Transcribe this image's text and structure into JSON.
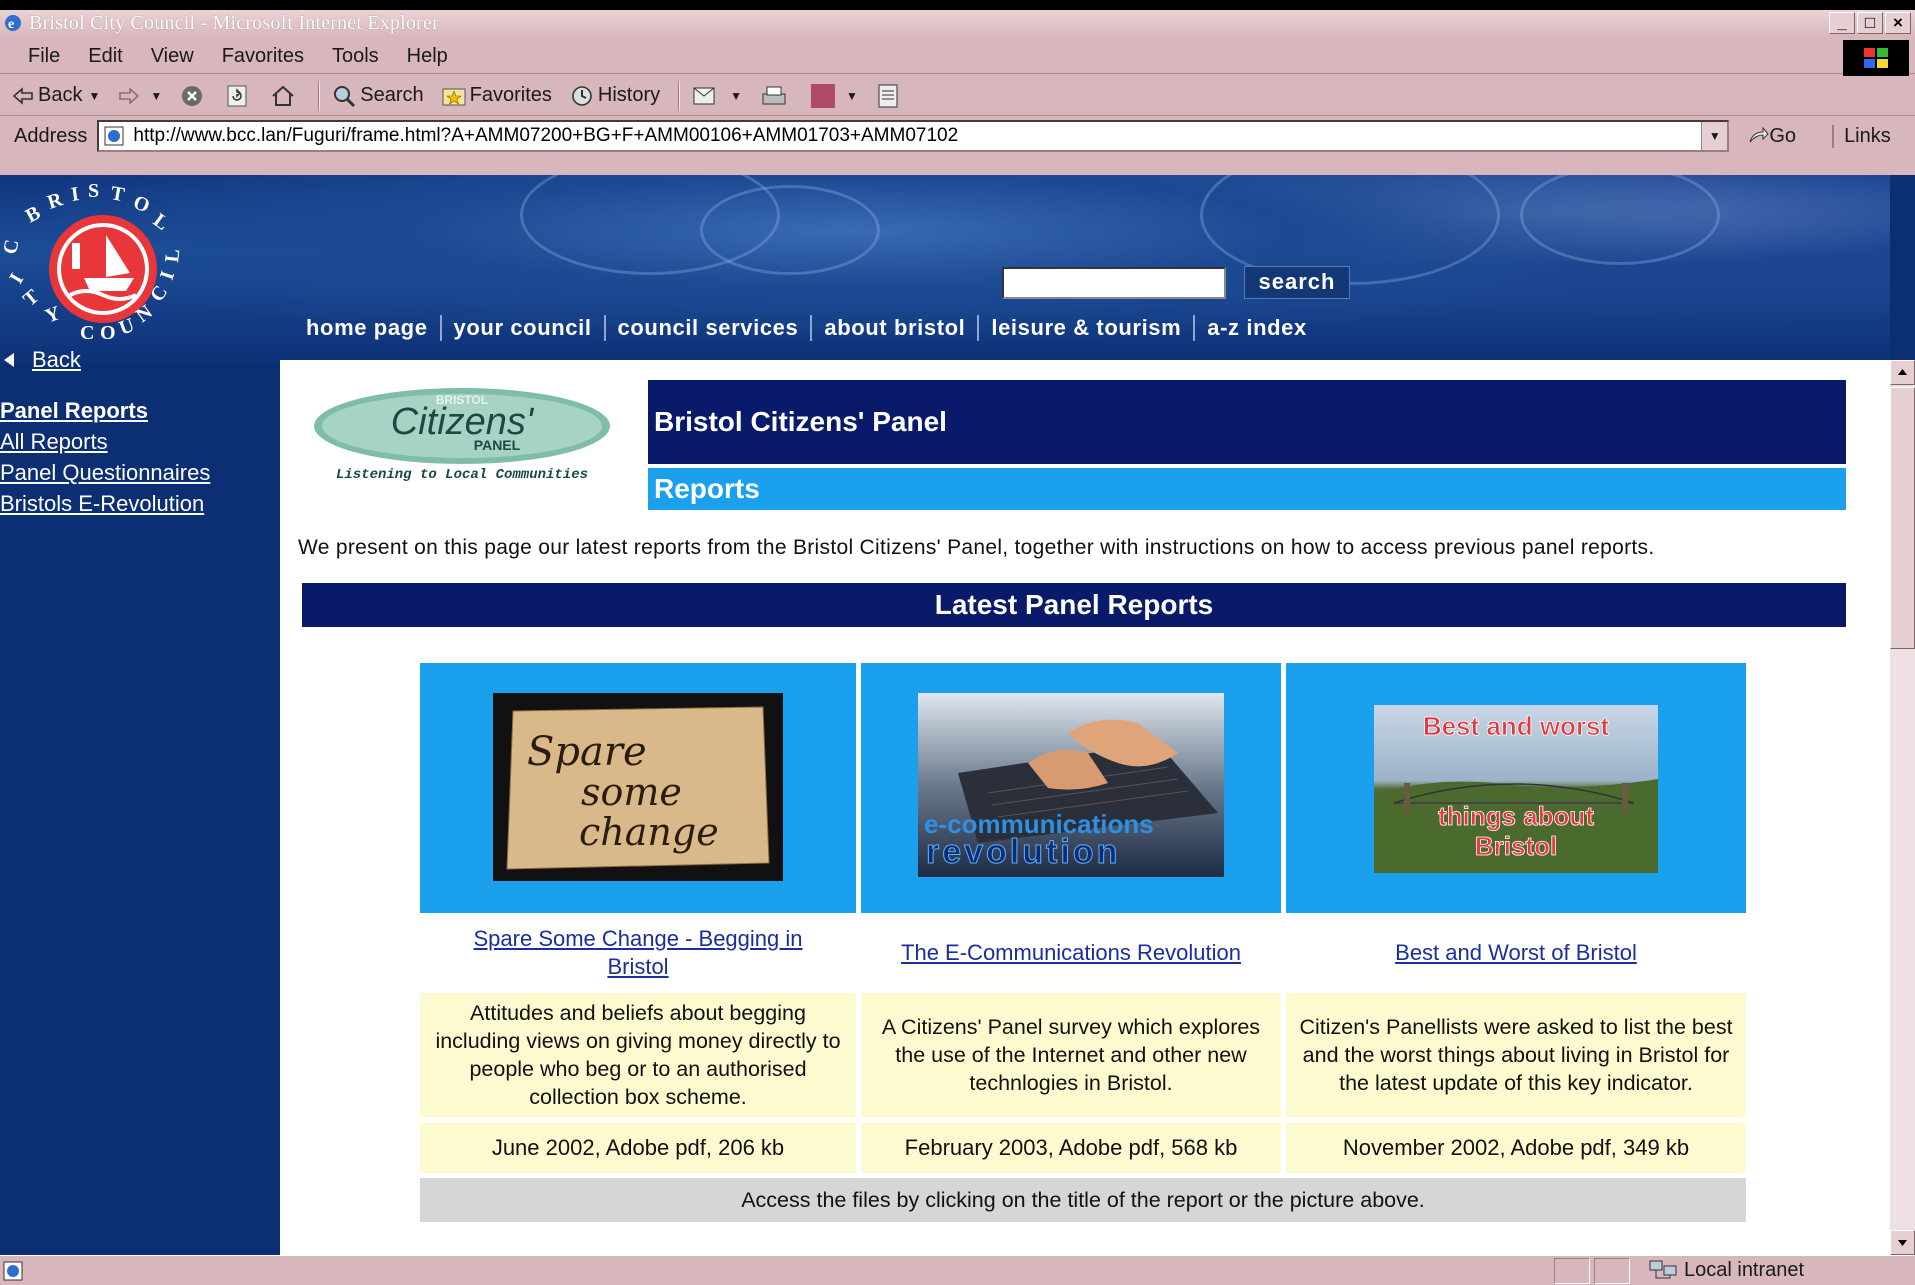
{
  "window": {
    "title": "Bristol City Council - Microsoft Internet Explorer",
    "buttons": {
      "minimize": "_",
      "maximize": "□",
      "close": "×"
    }
  },
  "menubar": [
    "File",
    "Edit",
    "View",
    "Favorites",
    "Tools",
    "Help"
  ],
  "toolbar": {
    "back": "Back",
    "search": "Search",
    "favorites": "Favorites",
    "history": "History"
  },
  "address": {
    "label": "Address",
    "url": "http://www.bcc.lan/Fuguri/frame.html?A+AMM07200+BG+F+AMM00106+AMM01703+AMM07102",
    "go": "Go",
    "links": "Links"
  },
  "site": {
    "logo_text": "BRISTOL CITY COUNCIL",
    "search_button": "search",
    "search_value": "",
    "nav": [
      "home page",
      "your council",
      "council services",
      "about bristol",
      "leisure & tourism",
      "a-z index"
    ]
  },
  "leftnav": {
    "back": "Back",
    "items": [
      "Panel Reports",
      "All Reports",
      "Panel Questionnaires",
      "Bristols E-Revolution"
    ]
  },
  "content": {
    "panel_logo": {
      "top": "BRISTOL",
      "main": "Citizens'",
      "sub": "PANEL",
      "tagline": "Listening to Local Communities"
    },
    "header1": "Bristol Citizens' Panel",
    "header2": "Reports",
    "intro": "We present on this page our latest reports from the Bristol Citizens' Panel, together with instructions on how to access previous panel reports.",
    "latest_title": "Latest Panel Reports",
    "reports": [
      {
        "image_text": [
          "Spare",
          "some",
          "change"
        ],
        "title": "Spare Some Change - Begging in Bristol",
        "description": "Attitudes and beliefs about begging including views on giving money directly to people who beg or to an authorised collection box scheme.",
        "meta": "June 2002, Adobe pdf, 206 kb"
      },
      {
        "image_text": [
          "e-communications",
          "revolution"
        ],
        "title": "The E-Communications Revolution",
        "description": "A Citizens' Panel survey which explores the use of the Internet and other new technlogies in Bristol.",
        "meta": "February 2003, Adobe pdf, 568 kb"
      },
      {
        "image_text": [
          "Best and worst",
          "things about",
          "Bristol"
        ],
        "title": "Best and Worst of Bristol",
        "description": "Citizen's Panellists were asked to list the best and the worst things about living in Bristol for the latest update of this key indicator.",
        "meta": "November 2002, Adobe pdf, 349 kb"
      }
    ],
    "access_note": "Access the files by clicking on the title of the report or the picture above."
  },
  "statusbar": {
    "zone": "Local intranet"
  },
  "colors": {
    "navy": "#0a1a6a",
    "sky": "#1ba0ee",
    "cream": "#fdfad0",
    "chrome": "#d7b7bb"
  }
}
